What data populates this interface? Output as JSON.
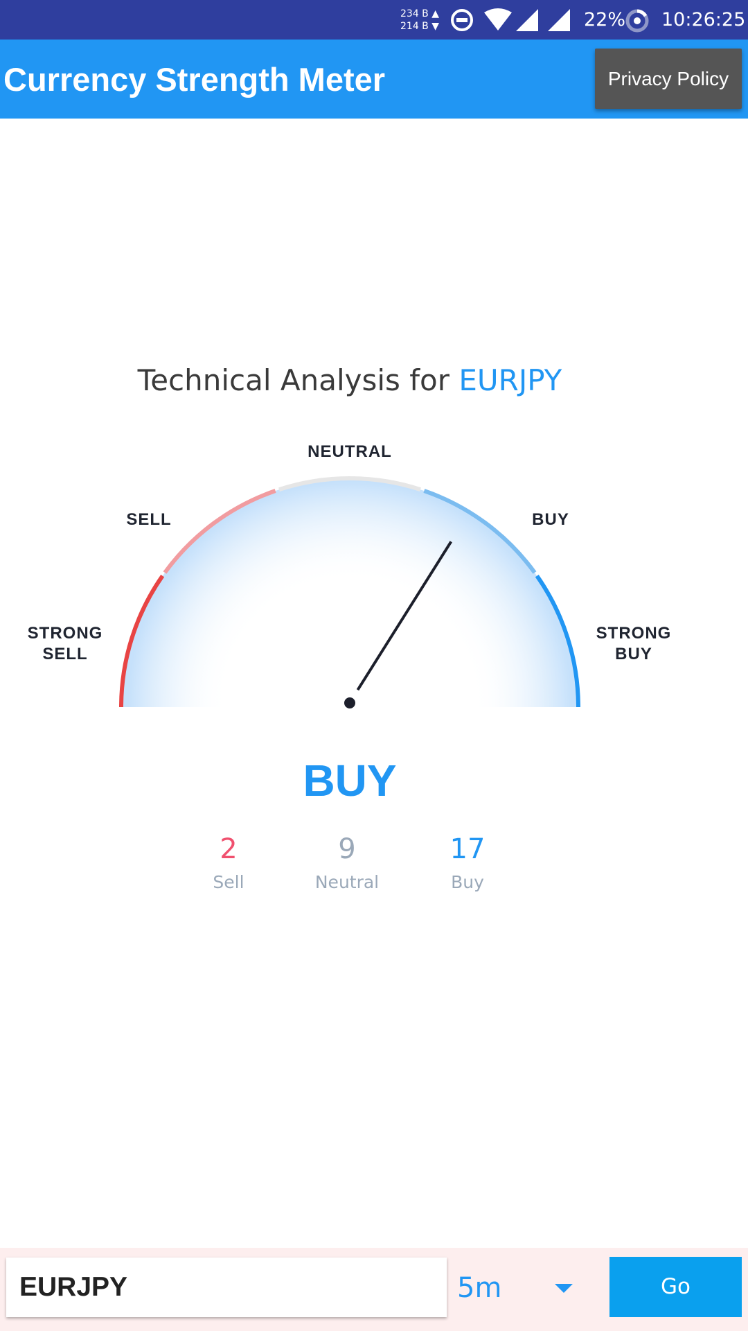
{
  "status_bar": {
    "net_up": "234 B ▲",
    "net_down": "214 B ▼",
    "battery": "22%",
    "time": "10:26:25",
    "icons": [
      "do-not-disturb-icon",
      "wifi-icon",
      "signal-icon",
      "signal-icon",
      "battery-ring-icon"
    ]
  },
  "app_bar": {
    "title": "Currency Strength Meter",
    "privacy_button": "Privacy Policy"
  },
  "analysis": {
    "title_prefix": "Technical Analysis for",
    "symbol": "EURJPY",
    "gauge": {
      "labels": {
        "strong_sell_line1": "STRONG",
        "strong_sell_line2": "SELL",
        "sell": "SELL",
        "neutral": "NEUTRAL",
        "buy": "BUY",
        "strong_buy_line1": "STRONG",
        "strong_buy_line2": "BUY"
      },
      "needle_value": 0.35,
      "value_range": [
        -1,
        1
      ],
      "segment_colors": {
        "strong_sell": "#e84444",
        "sell": "#f19ca0",
        "neutral": "#e6e6e6",
        "buy": "#7bbcf0",
        "strong_buy": "#2196f3"
      }
    },
    "verdict": "BUY",
    "counts": {
      "sell": {
        "value": "2",
        "label": "Sell",
        "color": "#f0506e"
      },
      "neutral": {
        "value": "9",
        "label": "Neutral",
        "color": "#9aa8b8"
      },
      "buy": {
        "value": "17",
        "label": "Buy",
        "color": "#2196f3"
      }
    }
  },
  "controls": {
    "symbol_value": "EURJPY",
    "timeframe": "5m",
    "go_button": "Go"
  },
  "colors": {
    "accent": "#2196f3",
    "status_bar": "#2f3e9e"
  }
}
